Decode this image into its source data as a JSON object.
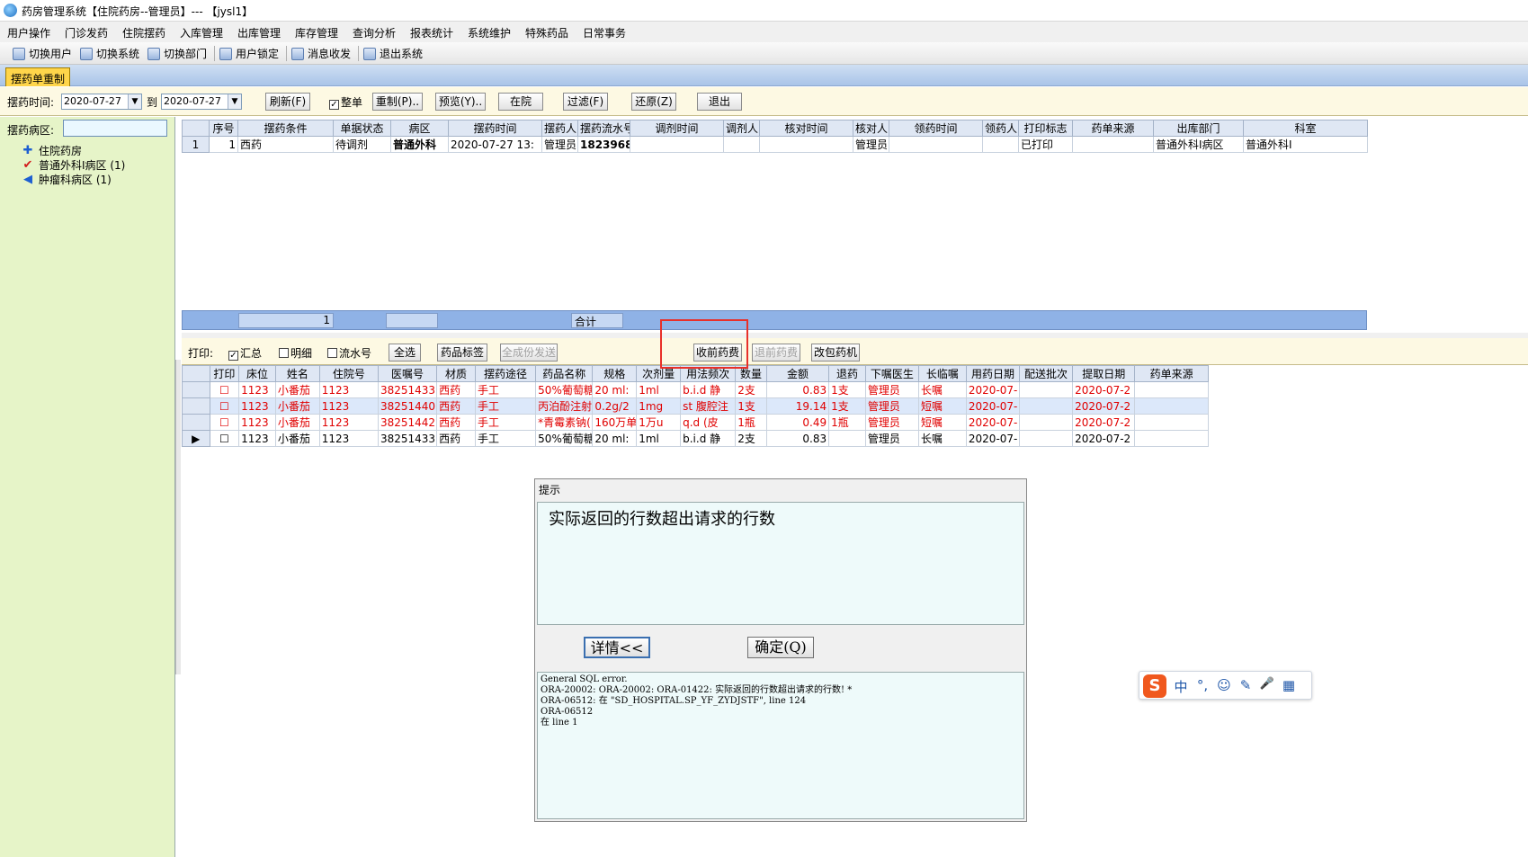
{
  "window": {
    "title": "药房管理系统【住院药房--管理员】--- 【jysl1】"
  },
  "menu": [
    "用户操作",
    "门诊发药",
    "住院摆药",
    "入库管理",
    "出库管理",
    "库存管理",
    "查询分析",
    "报表统计",
    "系统维护",
    "特殊药品",
    "日常事务"
  ],
  "toolbar": [
    {
      "label": "切换用户",
      "icon": "switch-user-icon"
    },
    {
      "label": "切换系统",
      "icon": "switch-system-icon"
    },
    {
      "label": "切换部门",
      "icon": "switch-dept-icon"
    },
    {
      "label": "用户锁定",
      "icon": "lock-icon"
    },
    {
      "label": "消息收发",
      "icon": "info-icon"
    },
    {
      "label": "退出系统",
      "icon": "exit-icon"
    }
  ],
  "tab": {
    "label": "摆药单重制"
  },
  "filter": {
    "time_label": "摆药时间:",
    "date_from": "2020-07-27",
    "to_label": "到",
    "date_to": "2020-07-27",
    "refresh": "刷新(F)",
    "whole_label": "整单",
    "whole_checked": true,
    "remake": "重制(P)..",
    "preview": "预览(Y)..",
    "in_hospital": "在院",
    "filter": "过滤(F)",
    "restore": "还原(Z)",
    "exit": "退出"
  },
  "left": {
    "ward_label": "摆药病区:",
    "ward_value": "",
    "tree": [
      {
        "label": "住院药房",
        "icon": "plus-icon"
      },
      {
        "label": "普通外科Ⅰ病区 (1)",
        "icon": "checkmark-icon"
      },
      {
        "label": "肿瘤科病区 (1)",
        "icon": "arrow-left-icon"
      }
    ]
  },
  "upper_grid": {
    "columns": [
      "序号",
      "摆药条件",
      "单据状态",
      "病区",
      "摆药时间",
      "摆药人",
      "摆药流水号",
      "调剂时间",
      "调剂人",
      "核对时间",
      "核对人",
      "领药时间",
      "领药人",
      "打印标志",
      "药单来源",
      "出库部门",
      "科室"
    ],
    "rows": [
      {
        "indicator": "1",
        "cells": [
          "1",
          "西药",
          "待调剂",
          "普通外科",
          "2020-07-27 13:",
          "管理员",
          "1823968",
          "",
          "",
          "",
          "管理员",
          "",
          "",
          "已打印",
          "",
          "普通外科Ⅰ病区",
          "普通外科Ⅰ"
        ]
      }
    ],
    "footer": {
      "count": "1",
      "total_label": "合计"
    }
  },
  "print_bar": {
    "print_label": "打印:",
    "summary": "汇总",
    "summary_checked": true,
    "detail": "明细",
    "detail_checked": false,
    "serial": "流水号",
    "serial_checked": false,
    "select_all": "全选",
    "drug_label": "药品标签",
    "full_send": "全成份发送",
    "collect_fee": "收前药费",
    "refund_fee": "退前药费",
    "pack_machine": "改包药机"
  },
  "lower_grid": {
    "columns": [
      "打印",
      "床位",
      "姓名",
      "住院号",
      "医嘱号",
      "材质",
      "摆药途径",
      "药品名称",
      "规格",
      "次剂量",
      "用法频次",
      "数量",
      "金额",
      "退药",
      "下嘱医生",
      "长临嘱",
      "用药日期",
      "配送批次",
      "提取日期",
      "药单来源"
    ],
    "rows": [
      {
        "style": "red",
        "indicator": "",
        "cells": [
          "☐",
          "1123",
          "小番茄",
          "1123",
          "38251433",
          "西药",
          "手工",
          "50%葡萄糖(",
          "20 ml:",
          "1ml",
          "b.i.d 静",
          "2支",
          "0.83",
          "1支",
          "管理员",
          "长嘱",
          "2020-07-",
          "",
          "2020-07-2",
          ""
        ]
      },
      {
        "style": "red sel",
        "indicator": "",
        "cells": [
          "☐",
          "1123",
          "小番茄",
          "1123",
          "38251440",
          "西药",
          "手工",
          "丙泊酚注射液",
          "0.2g/2",
          "1mg",
          "st 腹腔注",
          "1支",
          "19.14",
          "1支",
          "管理员",
          "短嘱",
          "2020-07-",
          "",
          "2020-07-2",
          ""
        ]
      },
      {
        "style": "red",
        "indicator": "",
        "cells": [
          "☐",
          "1123",
          "小番茄",
          "1123",
          "38251442",
          "西药",
          "手工",
          "*青霉素钠(",
          "160万单",
          "1万u",
          "q.d (皮",
          "1瓶",
          "0.49",
          "1瓶",
          "管理员",
          "短嘱",
          "2020-07-",
          "",
          "2020-07-2",
          ""
        ]
      },
      {
        "style": "",
        "indicator": "▶",
        "cells": [
          "☐",
          "1123",
          "小番茄",
          "1123",
          "38251433",
          "西药",
          "手工",
          "50%葡萄糖(",
          "20 ml:",
          "1ml",
          "b.i.d 静",
          "2支",
          "0.83",
          "",
          "管理员",
          "长嘱",
          "2020-07-",
          "",
          "2020-07-2",
          ""
        ]
      }
    ]
  },
  "dialog": {
    "title": "提示",
    "message": "实际返回的行数超出请求的行数",
    "details_button": "详情<<",
    "ok_button": "确定(Q)",
    "details": "General SQL error.\nORA-20002: ORA-20002: ORA-01422: 实际返回的行数超出请求的行数! *\nORA-06512: 在 \"SD_HOSPITAL.SP_YF_ZYDJSTF\", line 124\nORA-06512\n在 line 1"
  },
  "ime": {
    "logo": "S",
    "items": [
      "中",
      "°,",
      "☺",
      "✎",
      "🎤",
      "▦"
    ]
  },
  "colors": {
    "accent_red": "#e8302a",
    "tab_yellow": "#ffd54a",
    "panel_green": "#e6f4c8",
    "grid_header": "#dfe7f4"
  }
}
